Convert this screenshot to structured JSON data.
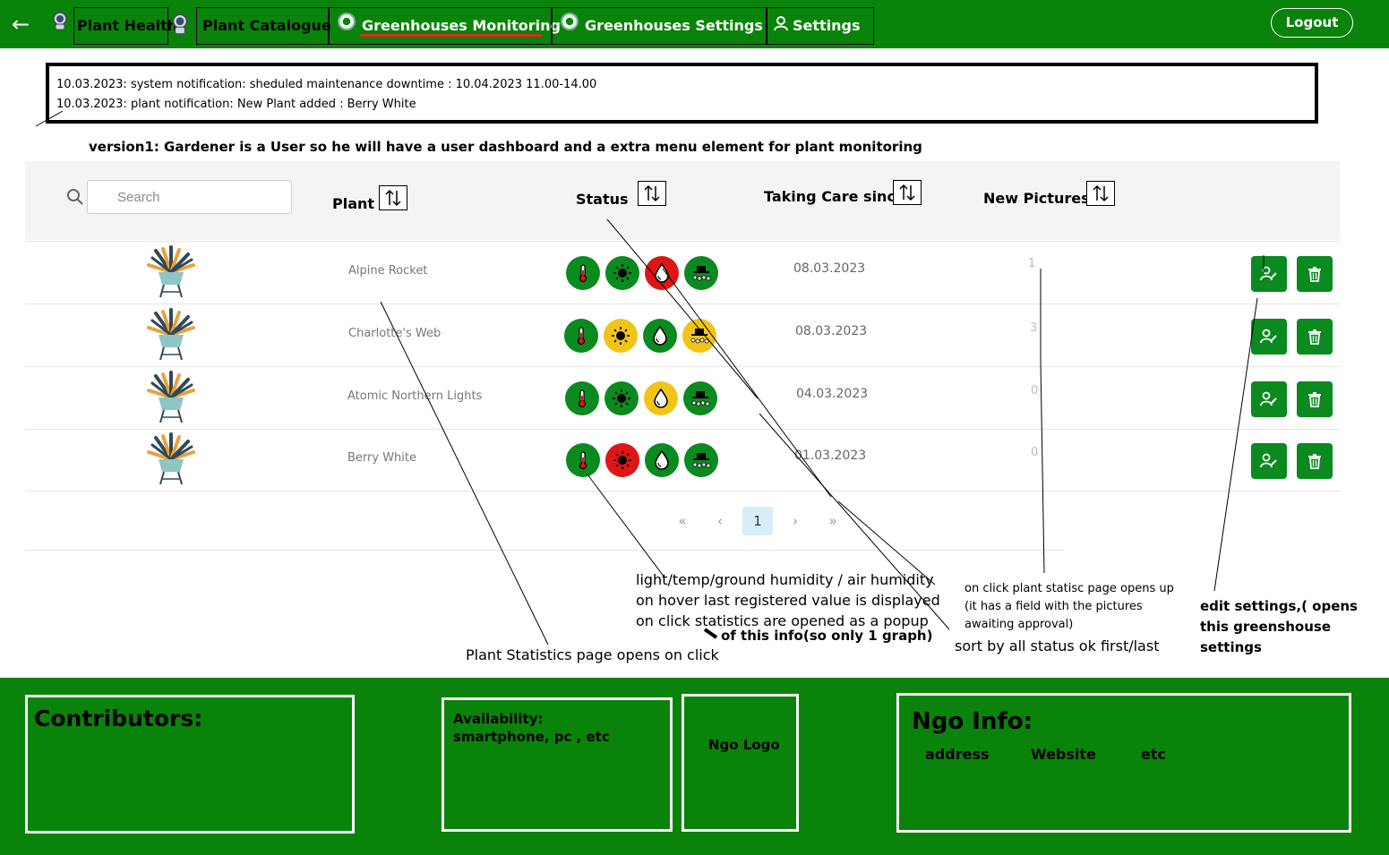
{
  "nav": {
    "back_icon": "arrow-left-icon",
    "tabs": [
      {
        "label": "Plant Health",
        "icon": "astronaut-icon"
      },
      {
        "label": "Plant Catalogue",
        "icon": ""
      },
      {
        "label": "Greenhouses Monitoring",
        "icon": "greenhouse-icon"
      },
      {
        "label": "Greenhouses Settings",
        "icon": "greenhouse-icon"
      },
      {
        "label": "Settings",
        "icon": "user-icon"
      }
    ],
    "logout": "Logout"
  },
  "notifications": [
    "10.03.2023: system notification: sheduled maintenance downtime : 10.04.2023 11.00-14.00",
    "10.03.2023: plant notification: New Plant added : Berry White"
  ],
  "version_note": "version1: Gardener is a User so he will have a user dashboard and a extra menu element for plant monitoring",
  "table": {
    "search_placeholder": "Search",
    "headers": {
      "plant": "Plant",
      "status": "Status",
      "taking_care_since": "Taking Care since",
      "new_pictures": "New Pictures"
    },
    "rows": [
      {
        "name": "Alpine Rocket",
        "date": "08.03.2023",
        "new_pictures": "1",
        "status": [
          "green",
          "green",
          "red",
          "green"
        ]
      },
      {
        "name": "Charlotte's Web",
        "date": "08.03.2023",
        "new_pictures": "3",
        "status": [
          "green",
          "yellow",
          "green",
          "yellow"
        ]
      },
      {
        "name": "Atomic Northern Lights",
        "date": "04.03.2023",
        "new_pictures": "0",
        "status": [
          "green",
          "green",
          "yellow",
          "green"
        ]
      },
      {
        "name": "Berry White",
        "date": "01.03.2023",
        "new_pictures": "0",
        "status": [
          "green",
          "red",
          "green",
          "green"
        ]
      }
    ],
    "status_icons": [
      "thermometer-icon",
      "sun-icon",
      "water-drop-icon",
      "air-humidity-icon"
    ],
    "status_colors": {
      "green": "#0a8a1f",
      "yellow": "#f2c417",
      "red": "#e01515"
    }
  },
  "pagination": {
    "first": "«",
    "prev": "‹",
    "current": "1",
    "next": "›",
    "last": "»"
  },
  "annotations": {
    "status_note_lines": [
      "light/temp/ground humidity / air humidity",
      "on hover last registered value is displayed",
      "on click statistics are opened as a popup"
    ],
    "status_note_bold": "of this info(so only 1 graph)",
    "plant_note": "Plant Statistics  page opens on click",
    "pictures_note_lines": [
      "on click plant statisc page opens up",
      "(it has a field with the pictures",
      "awaiting approval)"
    ],
    "sort_note": "sort by all status ok first/last",
    "settings_note_lines": [
      "edit settings,( opens",
      "this greenshouse",
      "settings"
    ]
  },
  "footer": {
    "contributors": "Contributors:",
    "availability_title": "Availability:",
    "availability_text": "smartphone, pc , etc",
    "ngo_logo": "Ngo Logo",
    "ngo_info": "Ngo Info:",
    "ngo_fields": [
      "address",
      "Website",
      "etc"
    ]
  }
}
